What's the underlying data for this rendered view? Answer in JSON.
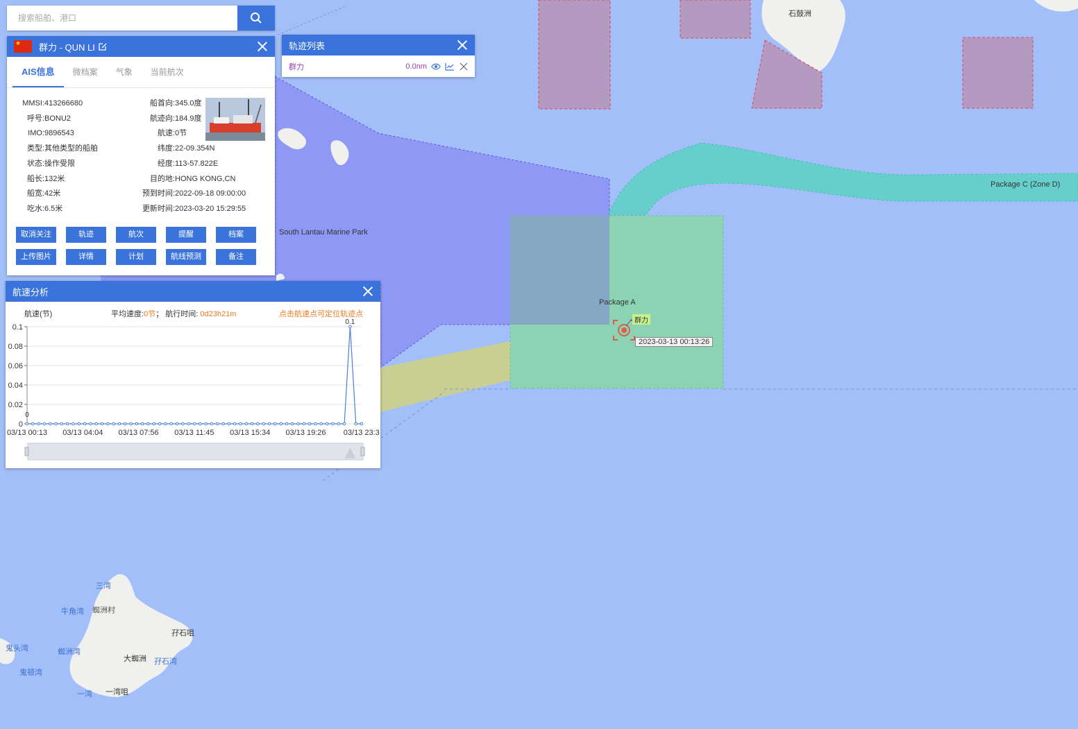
{
  "search": {
    "placeholder": "搜索船舶、港口",
    "icon": "search-icon"
  },
  "ship": {
    "name": "群力 - QUN LI",
    "flag_icon": "china-flag-icon",
    "tabs": [
      {
        "label": "AIS信息",
        "active": true
      },
      {
        "label": "微档案",
        "active": false
      },
      {
        "label": "气象",
        "active": false
      },
      {
        "label": "当前航次",
        "active": false
      }
    ],
    "left_fields": [
      {
        "label": "MMSI:",
        "value": "413266680"
      },
      {
        "label": "呼号:",
        "value": "BONU2"
      },
      {
        "label": "IMO:",
        "value": "9896543"
      },
      {
        "label": "类型:",
        "value": "其他类型的船舶"
      },
      {
        "label": "状态:",
        "value": "操作受限"
      },
      {
        "label": "船长:",
        "value": "132米"
      },
      {
        "label": "船宽:",
        "value": "42米"
      },
      {
        "label": "吃水:",
        "value": "6.5米"
      }
    ],
    "right_fields": [
      {
        "label": "船首向:",
        "value": "345.0度"
      },
      {
        "label": "航迹向:",
        "value": "184.9度"
      },
      {
        "label": "航速:",
        "value": "0节"
      },
      {
        "label": "纬度:",
        "value": "22-09.354N"
      },
      {
        "label": "经度:",
        "value": "113-57.822E"
      },
      {
        "label": "目的地:",
        "value": "HONG KONG,CN"
      },
      {
        "label": "预到时间:",
        "value": "2022-09-18 09:00:00"
      },
      {
        "label": "更新时间:",
        "value": "2023-03-20 15:29:55"
      }
    ],
    "buttons": [
      "取消关注",
      "轨迹",
      "航次",
      "提醒",
      "档案",
      "上传图片",
      "详情",
      "计划",
      "航线预测",
      "备注"
    ]
  },
  "track_list": {
    "title": "轨迹列表",
    "items": [
      {
        "name": "群力",
        "distance": "0.0nm"
      }
    ]
  },
  "speed_analysis": {
    "title": "航速分析",
    "y_label": "航速(节)",
    "avg_label": "平均速度:",
    "avg_value": "0节",
    "sep": "；",
    "time_label": "航行时间:",
    "time_value": "0d23h21m",
    "hint": "点击航速点可定位轨迹点"
  },
  "chart_data": {
    "type": "line",
    "title": "",
    "xlabel": "",
    "ylabel": "航速(节)",
    "ylim": [
      0,
      0.1
    ],
    "yticks": [
      "0",
      "0.02",
      "0.04",
      "0.06",
      "0.08",
      "0.1"
    ],
    "x_ticks": [
      "03/13 00:13",
      "03/13 04:04",
      "03/13 07:56",
      "03/13 11:45",
      "03/13 15:34",
      "03/13 19:26",
      "03/13 23:3"
    ],
    "series": [
      {
        "values": [
          0,
          0,
          0,
          0,
          0,
          0,
          0,
          0,
          0,
          0,
          0,
          0,
          0,
          0,
          0,
          0,
          0,
          0,
          0,
          0,
          0,
          0,
          0,
          0,
          0,
          0,
          0,
          0,
          0,
          0,
          0,
          0,
          0,
          0,
          0,
          0,
          0,
          0,
          0,
          0,
          0,
          0,
          0,
          0,
          0,
          0,
          0,
          0,
          0,
          0,
          0,
          0,
          0,
          0,
          0,
          0,
          0.1,
          0,
          0
        ]
      }
    ],
    "data_labels": {
      "first": "0",
      "max": "0.1"
    }
  },
  "map": {
    "labels": {
      "shek_kwu_chau": "石鼓洲",
      "marine_park": "South Lantau Marine Park",
      "package_c": "Package C (Zone D)",
      "package_a": "Package A",
      "ship_tag": "群力",
      "timestamp": "2023-03-13 00:13:26",
      "san_wan": "三湾",
      "ngau_kok_wan": "牛角湾",
      "village": "蜘洲村",
      "tsai_shek_tsui": "孖石咀",
      "kwai_tau_wan": "鬼头湾",
      "chi_chau_wan": "蜘洲湾",
      "tai_chi_chau": "大蜘洲",
      "tsai_shek_wan": "孖石湾",
      "kwai_tau_wan2": "鬼顿湾",
      "yat_wan": "一湾",
      "yat_wan_tsui": "一湾咀"
    }
  }
}
